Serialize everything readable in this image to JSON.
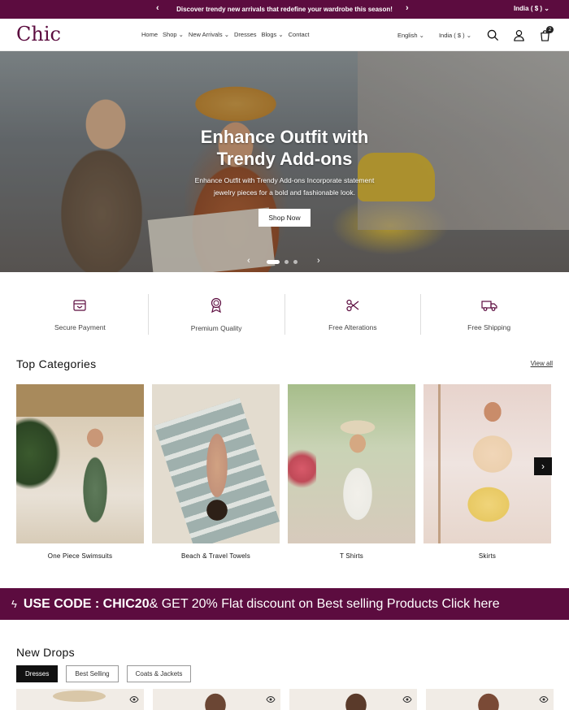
{
  "announcement": {
    "text": "Discover trendy new arrivals that redefine your wardrobe this season!",
    "region": "India ( $ )"
  },
  "header": {
    "logo": "Chic",
    "nav": [
      "Home",
      "Shop",
      "New Arrivals",
      "Dresses",
      "Blogs",
      "Contact"
    ],
    "language": "English",
    "currency": "India ( $ )",
    "cart_count": "2"
  },
  "hero": {
    "title_line1": "Enhance Outfit with",
    "title_line2": "Trendy Add-ons",
    "subtitle_line1": "Enhance Outfit with Trendy Add-ons Incorporate statement",
    "subtitle_line2": "jewelry pieces for a bold and fashionable look.",
    "button": "Shop Now"
  },
  "features": [
    {
      "label": "Secure Payment",
      "icon": "wallet-icon"
    },
    {
      "label": "Premium Quality",
      "icon": "award-icon"
    },
    {
      "label": "Free Alterations",
      "icon": "scissors-icon"
    },
    {
      "label": "Free Shipping",
      "icon": "truck-icon"
    }
  ],
  "categories": {
    "title": "Top Categories",
    "view_all": "View all",
    "items": [
      {
        "name": "One Piece Swimsuits"
      },
      {
        "name": "Beach & Travel Towels"
      },
      {
        "name": "T Shirts"
      },
      {
        "name": "Skirts"
      }
    ]
  },
  "promo": {
    "lead": "USE CODE : CHIC20",
    "rest": " & GET 20% Flat discount on Best selling Products Click here"
  },
  "new_drops": {
    "title": "New Drops",
    "tabs": [
      "Dresses",
      "Best Selling",
      "Coats & Jackets"
    ]
  },
  "colors": {
    "brand": "#5c0c3f"
  }
}
